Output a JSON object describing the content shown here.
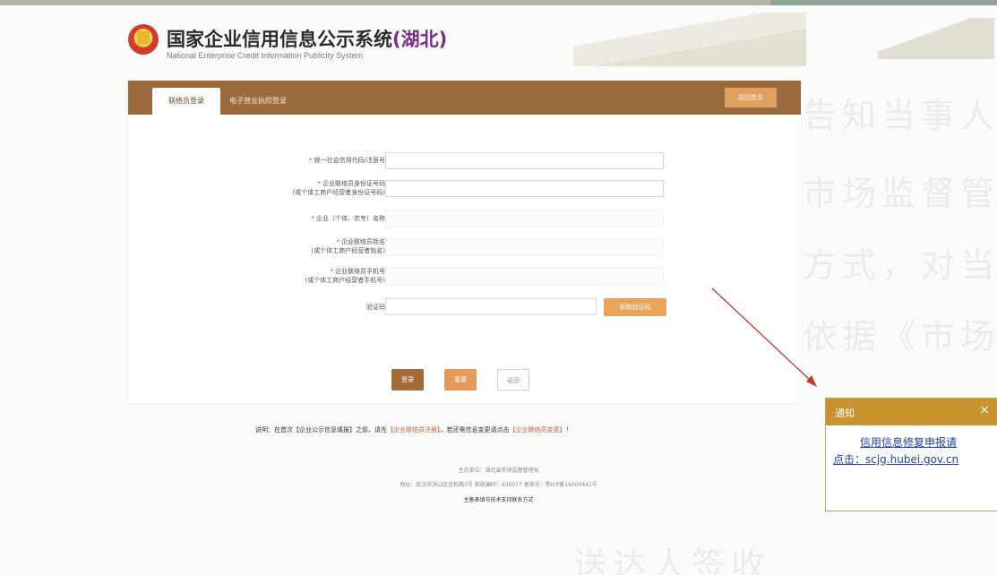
{
  "header": {
    "title": "国家企业信用信息公示系统",
    "province": "(湖北)",
    "subtitle": "National Enterprise Credit Information Publicity System"
  },
  "background_lines": [
    "告知当事人",
    "市场监督管",
    "方式，对当事",
    "依据《市场",
    "送达人签收"
  ],
  "tabs": {
    "active": "联络员登录",
    "other": "电子营业执照登录",
    "return": "返回首页"
  },
  "form": {
    "fields": [
      {
        "label": "统一社会信用代码/注册号",
        "required": true,
        "value": ""
      },
      {
        "label": "企业联络员身份证号码",
        "label2": "(或个体工商户经营者身份证号码)",
        "required": true,
        "value": ""
      },
      {
        "label": "企业（个体、农专）名称",
        "required": true,
        "value": ""
      },
      {
        "label": "企业联络员姓名",
        "label2": "(或个体工商户经营者姓名)",
        "required": true,
        "value": ""
      },
      {
        "label": "企业联络员手机号",
        "label2": "(或个体工商户经营者手机号)",
        "required": true,
        "value": ""
      }
    ],
    "code_label": "验证码",
    "get_code": "获取验证码",
    "login": "登录",
    "reset": "重置",
    "back": "返回"
  },
  "note": {
    "prefix": "说明：在首次【企业公示信息填报】之前，请先",
    "link1": "【企业联络员注册】",
    "middle": "，若还需信息变更请点击",
    "link2": "【企业联络员变更】",
    "suffix": "！"
  },
  "footer": {
    "line1": "主办单位：湖北省市场监督管理局",
    "line2": "地址：武汉市洪山区宜和路3号  邮政编码：430077  备案号：鄂ICP备16004442号",
    "line3": "主备表填与技术支持联系方式"
  },
  "notice": {
    "title": "通知",
    "close": "×",
    "line1": "信用信息修复申报请",
    "line2": "点击：scjg.hubei.gov.cn"
  },
  "colors": {
    "tab_bar": "#9b6a3d",
    "accent_orange": "#e8a55a",
    "notice_header": "#c8942f",
    "link_blue": "#1c3fb3",
    "arrow_red": "#b8402a"
  }
}
